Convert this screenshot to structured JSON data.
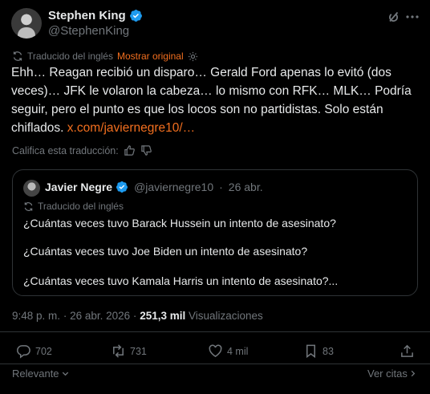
{
  "author": {
    "name": "Stephen King",
    "handle": "@StephenKing"
  },
  "translation": {
    "label": "Traducido del inglés",
    "show_original": "Mostrar original"
  },
  "post": {
    "text": "Ehh… Reagan recibió un disparo… Gerald Ford apenas lo evitó (dos veces)… JFK le volaron la cabeza… lo mismo con RFK… MLK… Podría seguir, pero el punto es que los locos son no partidistas. Solo están chiflados.",
    "link": "x.com/javiernegre10/…"
  },
  "rate_translation": {
    "label": "Califica esta traducción:"
  },
  "quote": {
    "name": "Javier Negre",
    "handle": "@javiernegre10",
    "separator": "·",
    "date": "26 abr.",
    "translated_label": "Traducido del inglés",
    "lines": [
      "¿Cuántas veces tuvo Barack Hussein un intento de asesinato?",
      "¿Cuántas veces tuvo Joe Biden un intento de asesinato?",
      "¿Cuántas veces tuvo Kamala Harris un intento de asesinato?..."
    ]
  },
  "meta": {
    "time": "9:48 p. m.",
    "separator": "·",
    "date": "26 abr. 2026",
    "views_count": "251,3 mil",
    "views_label": "Visualizaciones"
  },
  "actions": {
    "replies": "702",
    "reposts": "731",
    "likes": "4 mil",
    "bookmarks": "83"
  },
  "footer": {
    "sort_label": "Relevante",
    "quotes_label": "Ver citas"
  },
  "colors": {
    "background": "#000000",
    "text": "#e7e9ea",
    "muted": "#71767b",
    "accent": "#f26f1f",
    "verified": "#1d9bf0",
    "border": "#2f3336"
  },
  "icons": [
    "verified-badge-icon",
    "grok-icon",
    "more-icon",
    "translate-icon",
    "settings-icon",
    "thumbs-up-icon",
    "thumbs-down-icon",
    "reply-icon",
    "repost-icon",
    "like-icon",
    "bookmark-icon",
    "share-icon",
    "chevron-down-icon",
    "chevron-right-icon"
  ]
}
